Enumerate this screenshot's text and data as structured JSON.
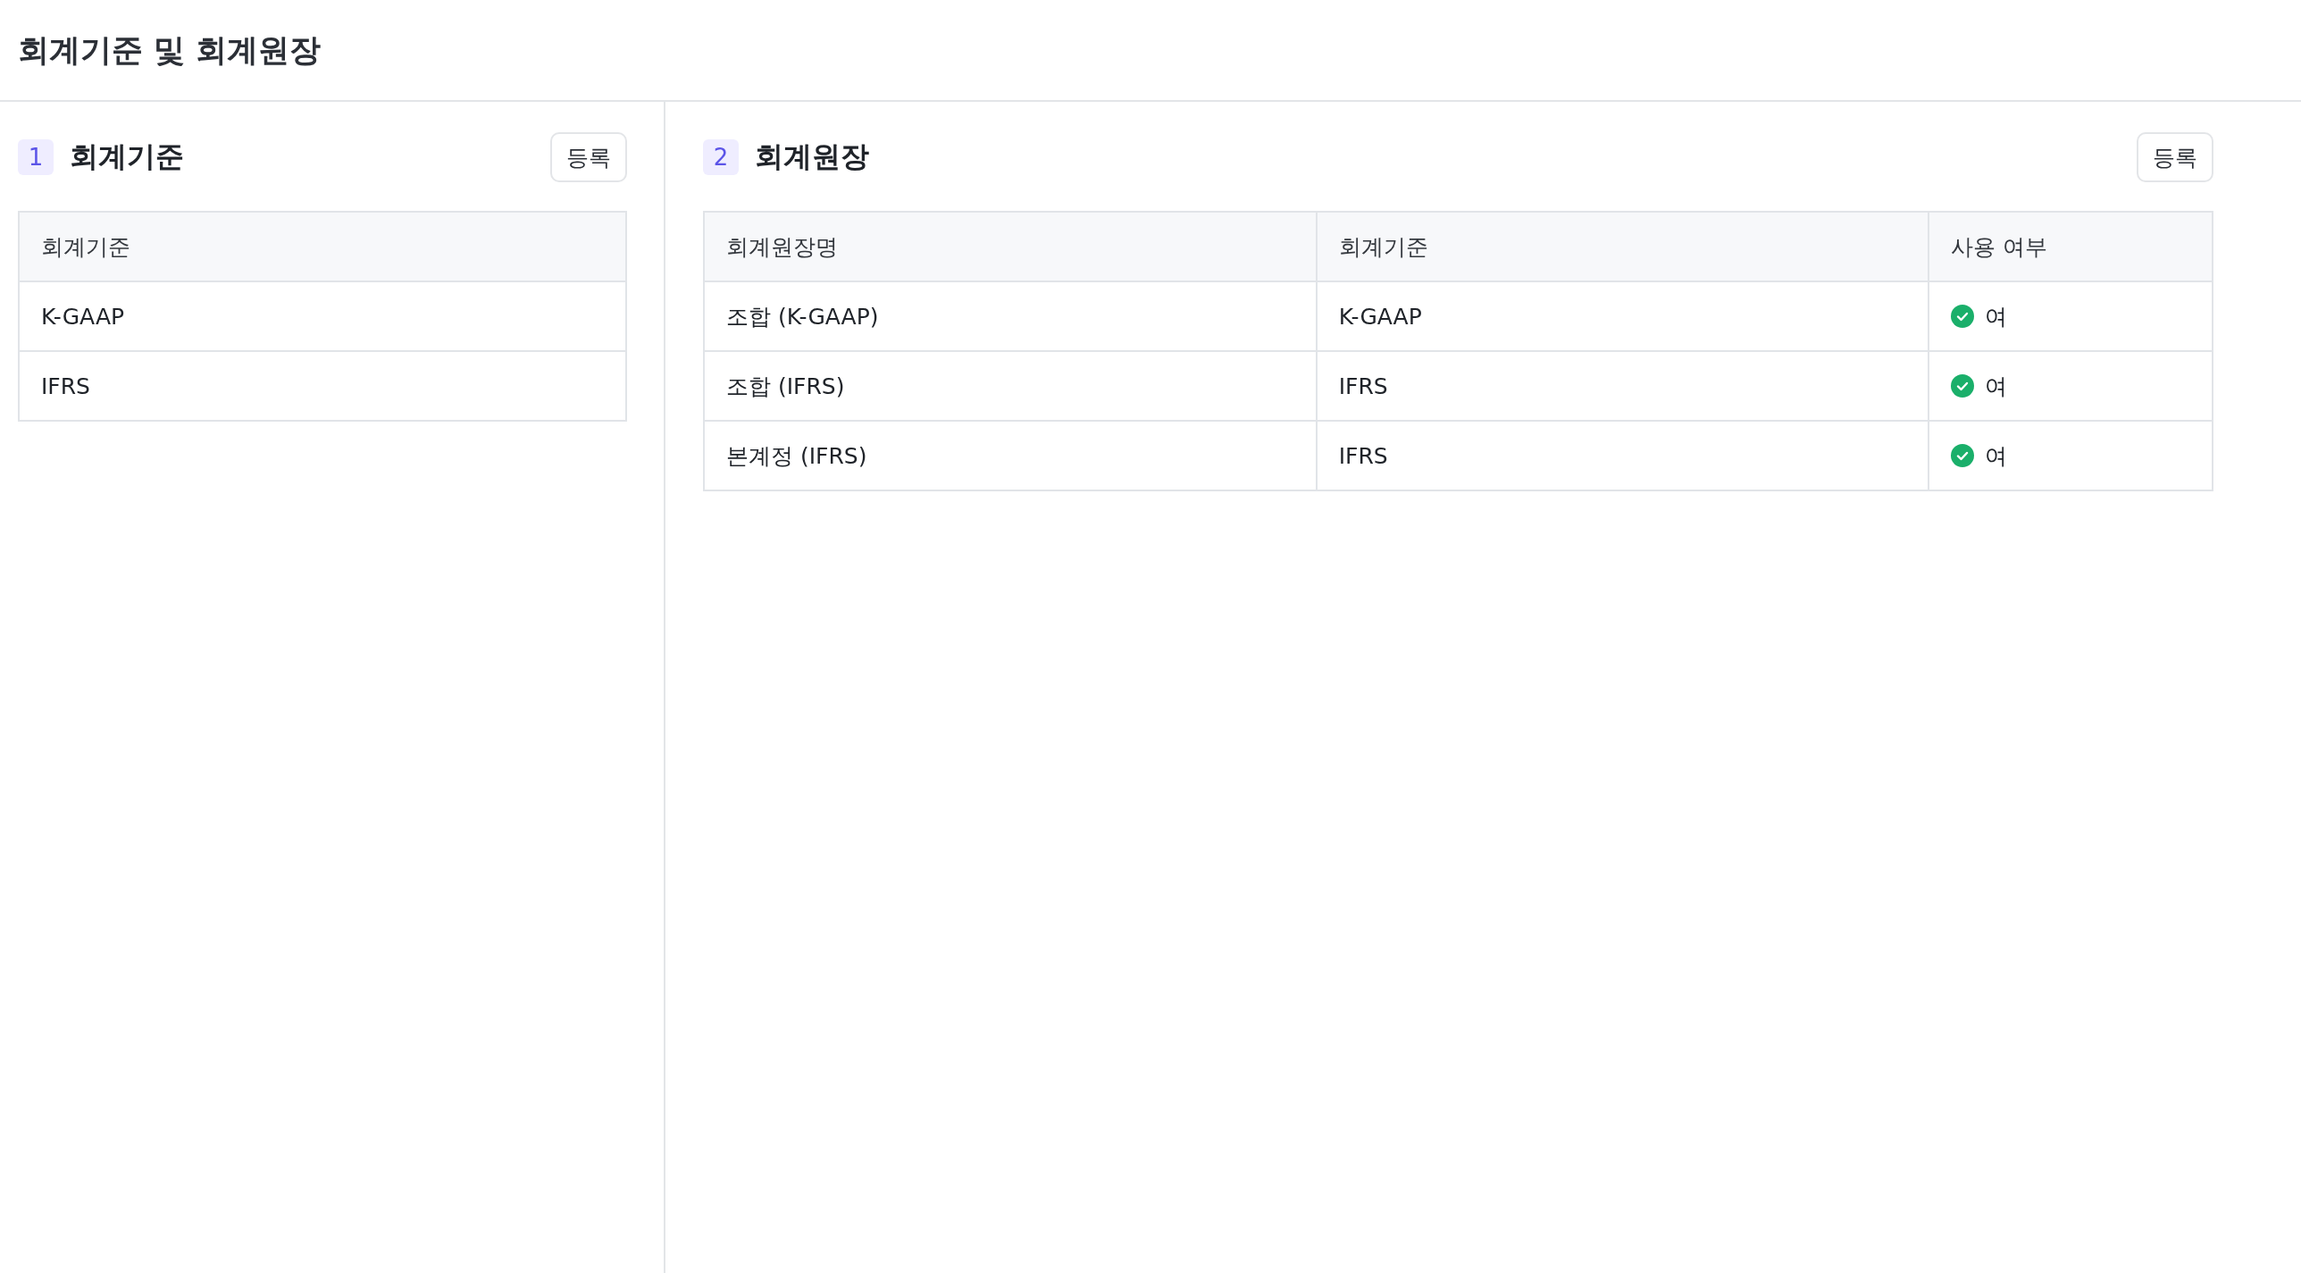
{
  "page": {
    "title": "회계기준 및 회계원장"
  },
  "standards_panel": {
    "number": "1",
    "title": "회계기준",
    "register_button": "등록",
    "columns": [
      "회계기준"
    ],
    "rows": [
      {
        "name": "K-GAAP"
      },
      {
        "name": "IFRS"
      }
    ]
  },
  "ledgers_panel": {
    "number": "2",
    "title": "회계원장",
    "register_button": "등록",
    "columns": [
      "회계원장명",
      "회계기준",
      "사용 여부"
    ],
    "rows": [
      {
        "name": "조합 (K-GAAP)",
        "standard": "K-GAAP",
        "in_use": true,
        "in_use_label": "여"
      },
      {
        "name": "조합 (IFRS)",
        "standard": "IFRS",
        "in_use": true,
        "in_use_label": "여"
      },
      {
        "name": "본계정 (IFRS)",
        "standard": "IFRS",
        "in_use": true,
        "in_use_label": "여"
      }
    ]
  }
}
